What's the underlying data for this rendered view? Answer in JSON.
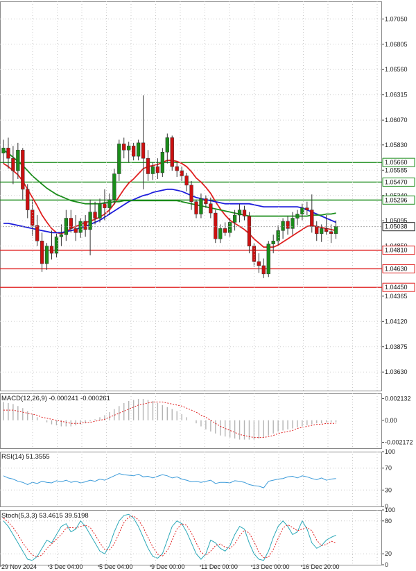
{
  "chart_data": {
    "type": "candlestick",
    "instrument_note": "",
    "x_tick_labels": [
      "29 Nov 2024",
      "3 Dec 04:00",
      "5 Dec 04:00",
      "9 Dec 00:00",
      "11 Dec 00:00",
      "13 Dec 00:00",
      "16 Dec 20:00"
    ],
    "price_axis": {
      "ticks": [
        "1.07050",
        "1.06805",
        "1.06560",
        "1.06315",
        "1.06070",
        "1.05830",
        "1.05585",
        "1.05340",
        "1.05095",
        "1.04850",
        "1.04365",
        "1.04120",
        "1.03875",
        "1.03630"
      ],
      "ylim": [
        1.0345,
        1.0722
      ]
    },
    "horizontal_levels": [
      {
        "value": "1.05660",
        "color": "#1a8c1a"
      },
      {
        "value": "1.05470",
        "color": "#1a8c1a"
      },
      {
        "value": "1.05296",
        "color": "#1a8c1a"
      },
      {
        "value": "1.04810",
        "color": "#e02020"
      },
      {
        "value": "1.04630",
        "color": "#e02020"
      },
      {
        "value": "1.04450",
        "color": "#e02020"
      }
    ],
    "current_price": "1.05038",
    "candles": [
      [
        1.0575,
        1.0588,
        1.0565,
        1.058
      ],
      [
        1.058,
        1.059,
        1.056,
        1.057
      ],
      [
        1.057,
        1.0582,
        1.0545,
        1.0558
      ],
      [
        1.0558,
        1.0585,
        1.055,
        1.0578
      ],
      [
        1.0578,
        1.058,
        1.053,
        1.054
      ],
      [
        1.054,
        1.0545,
        1.0512,
        1.052
      ],
      [
        1.052,
        1.053,
        1.0495,
        1.0505
      ],
      [
        1.0505,
        1.0515,
        1.0485,
        1.049
      ],
      [
        1.049,
        1.0498,
        1.046,
        1.0468
      ],
      [
        1.0468,
        1.0488,
        1.0462,
        1.0485
      ],
      [
        1.0485,
        1.05,
        1.0472,
        1.0478
      ],
      [
        1.0478,
        1.0497,
        1.0474,
        1.0494
      ],
      [
        1.0494,
        1.0506,
        1.0485,
        1.0496
      ],
      [
        1.0496,
        1.052,
        1.049,
        1.0512
      ],
      [
        1.0512,
        1.052,
        1.0498,
        1.0502
      ],
      [
        1.0502,
        1.0515,
        1.049,
        1.0498
      ],
      [
        1.0498,
        1.0512,
        1.0493,
        1.0509
      ],
      [
        1.0509,
        1.0515,
        1.0494,
        1.0501
      ],
      [
        1.0501,
        1.053,
        1.0476,
        1.0518
      ],
      [
        1.0518,
        1.0528,
        1.0506,
        1.0512
      ],
      [
        1.0512,
        1.0531,
        1.0508,
        1.0526
      ],
      [
        1.0526,
        1.054,
        1.051,
        1.0522
      ],
      [
        1.0522,
        1.0536,
        1.0515,
        1.053
      ],
      [
        1.053,
        1.056,
        1.0525,
        1.0555
      ],
      [
        1.0555,
        1.0588,
        1.0548,
        1.0584
      ],
      [
        1.0584,
        1.059,
        1.057,
        1.0578
      ],
      [
        1.0578,
        1.0586,
        1.0566,
        1.0582
      ],
      [
        1.0582,
        1.0585,
        1.0568,
        1.0572
      ],
      [
        1.0572,
        1.0588,
        1.0568,
        1.0585
      ],
      [
        1.0585,
        1.0631,
        1.054,
        1.057
      ],
      [
        1.057,
        1.0578,
        1.0548,
        1.0555
      ],
      [
        1.0555,
        1.0566,
        1.0549,
        1.0562
      ],
      [
        1.0562,
        1.057,
        1.055,
        1.0556
      ],
      [
        1.0556,
        1.058,
        1.0552,
        1.0576
      ],
      [
        1.0576,
        1.0594,
        1.0565,
        1.059
      ],
      [
        1.059,
        1.0592,
        1.0558,
        1.0562
      ],
      [
        1.0562,
        1.0566,
        1.0552,
        1.0558
      ],
      [
        1.0558,
        1.0562,
        1.0548,
        1.0553
      ],
      [
        1.0553,
        1.0556,
        1.0538,
        1.0544
      ],
      [
        1.0544,
        1.0548,
        1.052,
        1.0528
      ],
      [
        1.0528,
        1.053,
        1.0512,
        1.0516
      ],
      [
        1.0516,
        1.0536,
        1.0512,
        1.0531
      ],
      [
        1.0531,
        1.0534,
        1.0522,
        1.0526
      ],
      [
        1.0526,
        1.0532,
        1.0512,
        1.0517
      ],
      [
        1.0517,
        1.052,
        1.0488,
        1.0492
      ],
      [
        1.0492,
        1.0506,
        1.0488,
        1.0502
      ],
      [
        1.0502,
        1.0508,
        1.0495,
        1.0498
      ],
      [
        1.0498,
        1.0512,
        1.0494,
        1.0508
      ],
      [
        1.0508,
        1.052,
        1.05,
        1.0515
      ],
      [
        1.0515,
        1.0526,
        1.0508,
        1.052
      ],
      [
        1.052,
        1.0524,
        1.051,
        1.0514
      ],
      [
        1.0514,
        1.0518,
        1.0478,
        1.0485
      ],
      [
        1.0485,
        1.0488,
        1.0465,
        1.047
      ],
      [
        1.047,
        1.0478,
        1.0459,
        1.0466
      ],
      [
        1.0466,
        1.0473,
        1.0454,
        1.0458
      ],
      [
        1.0458,
        1.049,
        1.0455,
        1.0487
      ],
      [
        1.0487,
        1.0496,
        1.0478,
        1.049
      ],
      [
        1.049,
        1.0505,
        1.0486,
        1.05
      ],
      [
        1.05,
        1.0512,
        1.0492,
        1.0509
      ],
      [
        1.0509,
        1.0514,
        1.0496,
        1.0502
      ],
      [
        1.0502,
        1.0518,
        1.0496,
        1.0512
      ],
      [
        1.0512,
        1.052,
        1.0505,
        1.0516
      ],
      [
        1.0516,
        1.0526,
        1.051,
        1.0522
      ],
      [
        1.0522,
        1.0528,
        1.0515,
        1.052
      ],
      [
        1.052,
        1.0535,
        1.0498,
        1.0504
      ],
      [
        1.0504,
        1.0509,
        1.049,
        1.0497
      ],
      [
        1.0497,
        1.0506,
        1.0489,
        1.0502
      ],
      [
        1.0502,
        1.0515,
        1.0496,
        1.0499
      ],
      [
        1.0499,
        1.0506,
        1.0488,
        1.0497
      ],
      [
        1.0497,
        1.051,
        1.0492,
        1.0504
      ]
    ],
    "overlays": [
      {
        "color": "#e02020",
        "values": [
          1.0565,
          1.0562,
          1.0558,
          1.0554,
          1.0548,
          1.054,
          1.0532,
          1.0524,
          1.0515,
          1.0508,
          1.0502,
          1.0498,
          1.0497,
          1.0499,
          1.0502,
          1.0504,
          1.0506,
          1.0508,
          1.0509,
          1.0511,
          1.0513,
          1.0516,
          1.052,
          1.0526,
          1.0533,
          1.054,
          1.0546,
          1.055,
          1.0555,
          1.056,
          1.0562,
          1.0563,
          1.0564,
          1.0566,
          1.0568,
          1.0568,
          1.0567,
          1.0565,
          1.0562,
          1.0557,
          1.0551,
          1.0547,
          1.0542,
          1.0536,
          1.0528,
          1.0521,
          1.0515,
          1.051,
          1.0507,
          1.0504,
          1.0501,
          1.0497,
          1.0492,
          1.0488,
          1.0484,
          1.0484,
          1.0484,
          1.0486,
          1.0489,
          1.0492,
          1.0495,
          1.0498,
          1.0501,
          1.0504,
          1.0505,
          1.0504,
          1.0503,
          1.0502,
          1.0501,
          1.05
        ]
      },
      {
        "color": "#1c1cdc",
        "values": [
          1.0507,
          1.0507,
          1.0506,
          1.0505,
          1.0504,
          1.0503,
          1.0502,
          1.0501,
          1.05,
          1.0499,
          1.0498,
          1.0498,
          1.0498,
          1.0499,
          1.05,
          1.0501,
          1.0503,
          1.0504,
          1.0506,
          1.0508,
          1.051,
          1.0513,
          1.0516,
          1.0519,
          1.0522,
          1.0525,
          1.0528,
          1.053,
          1.0532,
          1.0534,
          1.0535,
          1.0537,
          1.0538,
          1.0539,
          1.054,
          1.054,
          1.0539,
          1.0538,
          1.0536,
          1.0534,
          1.0532,
          1.0531,
          1.053,
          1.0529,
          1.0528,
          1.0527,
          1.0526,
          1.0526,
          1.0526,
          1.0526,
          1.0526,
          1.0526,
          1.0525,
          1.0524,
          1.0523,
          1.0523,
          1.0523,
          1.0523,
          1.0523,
          1.0523,
          1.0523,
          1.0523,
          1.0522,
          1.052,
          1.0518,
          1.0516,
          1.0514,
          1.0512,
          1.051,
          1.0508
        ]
      },
      {
        "color": "#1a8c1a",
        "values": [
          1.0578,
          1.0575,
          1.0571,
          1.0567,
          1.0563,
          1.0558,
          1.0553,
          1.0549,
          1.0545,
          1.0541,
          1.0538,
          1.0535,
          1.0533,
          1.0531,
          1.0529,
          1.0528,
          1.0527,
          1.0526,
          1.0526,
          1.0526,
          1.0526,
          1.0527,
          1.0527,
          1.0528,
          1.0528,
          1.0529,
          1.0529,
          1.0529,
          1.0529,
          1.0529,
          1.0529,
          1.0529,
          1.0529,
          1.0529,
          1.0529,
          1.0529,
          1.0529,
          1.0528,
          1.0527,
          1.0526,
          1.0525,
          1.0524,
          1.0523,
          1.0522,
          1.0521,
          1.052,
          1.0519,
          1.0518,
          1.0517,
          1.0516,
          1.0515,
          1.0514,
          1.0514,
          1.0514,
          1.0514,
          1.0514,
          1.0514,
          1.0514,
          1.0514,
          1.0514,
          1.0514,
          1.0514,
          1.0514,
          1.0514,
          1.0515,
          1.0515,
          1.0515,
          1.0516,
          1.0516,
          1.0517
        ]
      }
    ],
    "macd": {
      "label": "MACD(12,26,9) -0.000241 -0.000261",
      "ticks": [
        "0.002132",
        "0.00",
        "-0.002172"
      ],
      "ylim": [
        -0.00275,
        0.00265
      ],
      "histogram": [
        0.0018,
        0.0017,
        0.0016,
        0.0014,
        0.0012,
        0.0009,
        0.0006,
        0.0003,
        0.0,
        -0.0002,
        -0.0004,
        -0.0005,
        -0.0006,
        -0.0006,
        -0.0006,
        -0.0005,
        -0.0004,
        -0.0003,
        -0.0001,
        0.0001,
        0.0003,
        0.0005,
        0.0008,
        0.0011,
        0.0014,
        0.0017,
        0.0019,
        0.002,
        0.0021,
        0.0021,
        0.002,
        0.0019,
        0.0017,
        0.0015,
        0.0013,
        0.0011,
        0.0009,
        0.0006,
        0.0003,
        0.0,
        -0.0003,
        -0.0006,
        -0.0009,
        -0.0011,
        -0.0013,
        -0.0015,
        -0.0016,
        -0.0017,
        -0.0018,
        -0.0019,
        -0.0019,
        -0.0019,
        -0.0019,
        -0.0018,
        -0.0017,
        -0.0015,
        -0.0013,
        -0.0011,
        -0.001,
        -0.0009,
        -0.0008,
        -0.0007,
        -0.0006,
        -0.0005,
        -0.0004,
        -0.0003,
        -0.0003,
        -0.0002,
        -0.0002,
        -0.0002
      ],
      "signal": [
        0.001,
        0.001,
        0.001,
        0.0009,
        0.0008,
        0.0007,
        0.0006,
        0.0005,
        0.0003,
        0.0002,
        0.0001,
        0.0,
        -0.0001,
        -0.0002,
        -0.0003,
        -0.0003,
        -0.0003,
        -0.0002,
        -0.0002,
        -0.0001,
        0.0,
        0.0001,
        0.0003,
        0.0005,
        0.0007,
        0.0009,
        0.0011,
        0.0013,
        0.0015,
        0.0016,
        0.0017,
        0.0018,
        0.0018,
        0.0018,
        0.0017,
        0.0016,
        0.0015,
        0.0014,
        0.0012,
        0.001,
        0.0008,
        0.0005,
        0.0003,
        0.0,
        -0.0003,
        -0.0006,
        -0.0008,
        -0.001,
        -0.0012,
        -0.0014,
        -0.0015,
        -0.0016,
        -0.0017,
        -0.0017,
        -0.0017,
        -0.0016,
        -0.0015,
        -0.0013,
        -0.0012,
        -0.0011,
        -0.001,
        -0.0008,
        -0.0007,
        -0.0006,
        -0.0005,
        -0.0004,
        -0.0004,
        -0.0003,
        -0.0003,
        -0.0003
      ]
    },
    "rsi": {
      "label": "RSI(14) 51.3555",
      "ticks": [
        "100",
        "70",
        "30",
        "0"
      ],
      "ylim": [
        0,
        100
      ],
      "values": [
        56,
        52,
        50,
        46,
        44,
        40,
        44,
        42,
        46,
        44,
        43,
        47,
        45,
        48,
        44,
        46,
        43,
        45,
        48,
        46,
        50,
        48,
        52,
        56,
        60,
        58,
        57,
        56,
        59,
        54,
        55,
        52,
        55,
        58,
        56,
        52,
        54,
        50,
        48,
        45,
        46,
        44,
        46,
        48,
        42,
        44,
        44,
        43,
        47,
        46,
        44,
        40,
        38,
        37,
        34,
        46,
        48,
        50,
        51,
        54,
        55,
        52,
        56,
        54,
        51,
        49,
        52,
        48,
        50,
        51
      ]
    },
    "stoch": {
      "label": "Stoch(5,3,3) 53.4615 39.5198",
      "ticks": [
        "100",
        "80",
        "20",
        "0"
      ],
      "ylim": [
        0,
        100
      ],
      "k": [
        80,
        70,
        55,
        40,
        25,
        10,
        8,
        15,
        30,
        45,
        40,
        55,
        70,
        75,
        60,
        65,
        80,
        70,
        55,
        40,
        25,
        20,
        35,
        60,
        80,
        90,
        92,
        85,
        70,
        50,
        30,
        15,
        12,
        20,
        45,
        70,
        80,
        75,
        60,
        40,
        20,
        10,
        20,
        45,
        40,
        30,
        25,
        35,
        55,
        70,
        65,
        40,
        20,
        10,
        8,
        25,
        50,
        70,
        80,
        70,
        55,
        60,
        80,
        65,
        40,
        30,
        35,
        45,
        50,
        54
      ],
      "d": [
        85,
        78,
        68,
        55,
        40,
        28,
        18,
        14,
        18,
        30,
        38,
        47,
        55,
        67,
        68,
        67,
        70,
        72,
        68,
        55,
        40,
        28,
        27,
        38,
        58,
        77,
        87,
        89,
        82,
        68,
        50,
        32,
        19,
        16,
        26,
        45,
        65,
        75,
        72,
        58,
        40,
        23,
        17,
        25,
        35,
        38,
        32,
        30,
        38,
        53,
        63,
        58,
        42,
        23,
        13,
        14,
        28,
        48,
        67,
        73,
        68,
        62,
        65,
        68,
        62,
        45,
        35,
        37,
        43,
        40
      ]
    }
  }
}
